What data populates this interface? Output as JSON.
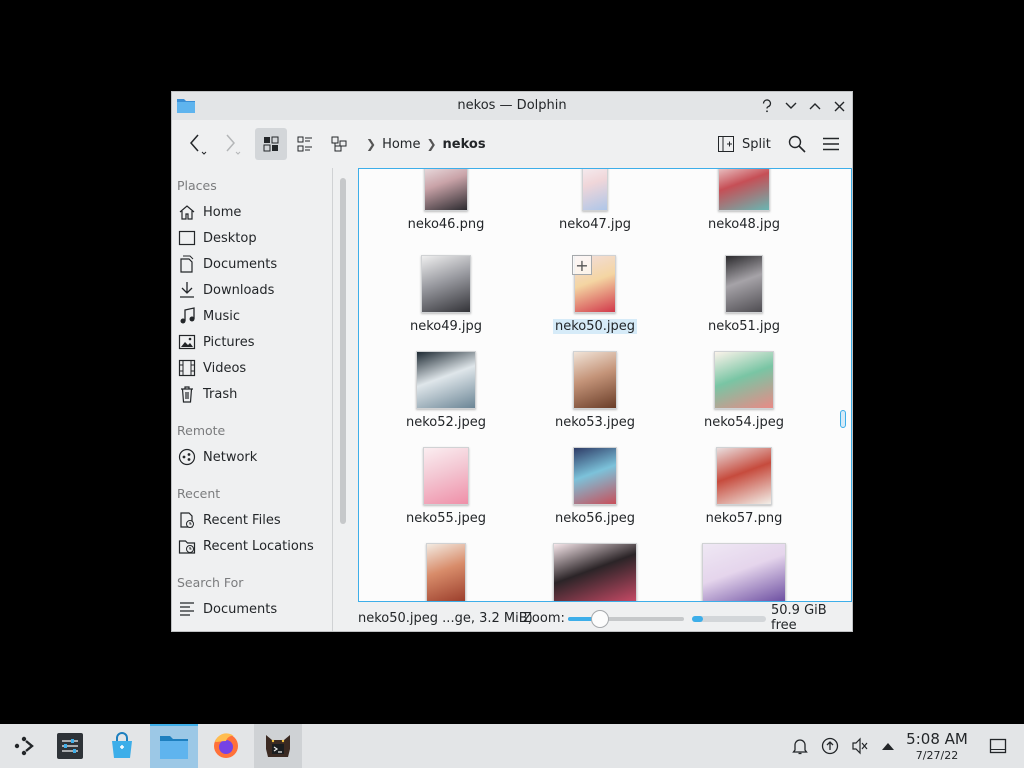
{
  "window": {
    "title": "nekos — Dolphin"
  },
  "toolbar": {
    "breadcrumbs": [
      "Home",
      "nekos"
    ],
    "split_label": "Split"
  },
  "places": {
    "sections": [
      {
        "heading": "Places",
        "items": [
          "Home",
          "Desktop",
          "Documents",
          "Downloads",
          "Music",
          "Pictures",
          "Videos",
          "Trash"
        ]
      },
      {
        "heading": "Remote",
        "items": [
          "Network"
        ]
      },
      {
        "heading": "Recent",
        "items": [
          "Recent Files",
          "Recent Locations"
        ]
      },
      {
        "heading": "Search For",
        "items": [
          "Documents"
        ]
      }
    ]
  },
  "files": [
    {
      "name": "neko46.png",
      "colors": [
        "#f3eef0",
        "#2c2b30",
        "#c9a3a8"
      ]
    },
    {
      "name": "neko47.jpg",
      "colors": [
        "#f6f4f8",
        "#aec6e8",
        "#f0d6d9"
      ]
    },
    {
      "name": "neko48.jpg",
      "colors": [
        "#f4e9e8",
        "#68b7b3",
        "#c64f56"
      ]
    },
    {
      "name": "neko49.jpg",
      "colors": [
        "#efefef",
        "#333338",
        "#999aa0"
      ]
    },
    {
      "name": "neko50.jpeg",
      "colors": [
        "#f2dede",
        "#d1384a",
        "#f4d5a2"
      ],
      "selected": true
    },
    {
      "name": "neko51.jpg",
      "colors": [
        "#2b2a2d",
        "#4f4d52",
        "#a6a3a8"
      ]
    },
    {
      "name": "neko52.jpeg",
      "colors": [
        "#1e2a33",
        "#6b8595",
        "#dfe6ea"
      ]
    },
    {
      "name": "neko53.jpeg",
      "colors": [
        "#f1e4d8",
        "#6a3d28",
        "#c49479"
      ]
    },
    {
      "name": "neko54.jpeg",
      "colors": [
        "#fbf3ea",
        "#e98a86",
        "#79c5a4"
      ]
    },
    {
      "name": "neko55.jpeg",
      "colors": [
        "#fbeef1",
        "#ef8fa8",
        "#f3c6d2"
      ]
    },
    {
      "name": "neko56.jpeg",
      "colors": [
        "#2e3b66",
        "#c84f5a",
        "#7cc2da"
      ]
    },
    {
      "name": "neko57.png",
      "colors": [
        "#e9dede",
        "#f2efe9",
        "#c64b3d"
      ]
    },
    {
      "name": "",
      "colors": [
        "#f3ebe2",
        "#9a3d2b",
        "#d88c6a"
      ]
    },
    {
      "name": "",
      "colors": [
        "#f6e6ea",
        "#c84a66",
        "#2b2427"
      ]
    },
    {
      "name": "",
      "colors": [
        "#efe8f4",
        "#6b4da0",
        "#e5d5ec"
      ]
    }
  ],
  "status": {
    "selection_info": "neko50.jpeg ...ge, 3.2 MiB)",
    "zoom_label": "Zoom:",
    "zoom_level": 0.28,
    "disk_used_fraction": 0.15,
    "free_space": "50.9 GiB free"
  },
  "taskbar": {
    "clock_time": "5:08 AM",
    "clock_date": "7/27/22"
  },
  "colors": {
    "accent": "#3daee9",
    "window_bg": "#eff0f1",
    "view_bg": "#fcfcfc",
    "selection": "#d6ebf8"
  }
}
